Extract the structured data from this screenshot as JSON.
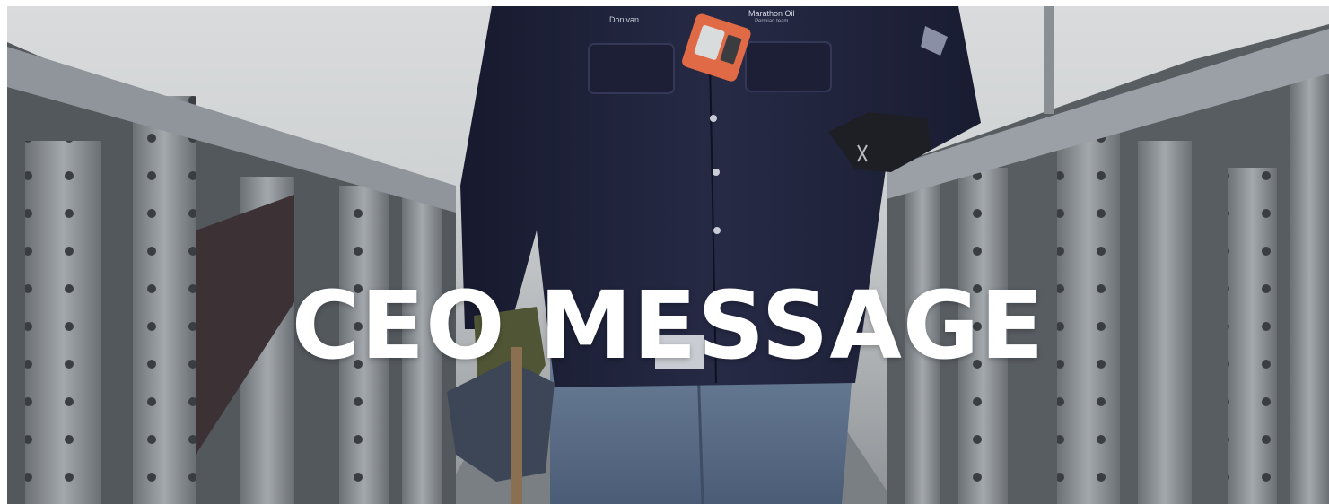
{
  "hero": {
    "headline": "CEO MESSAGE",
    "name_tag": "Donivan",
    "brand_logo": "Marathon Oil",
    "brand_logo_sub": "Permian team"
  },
  "colors": {
    "headline": "#ffffff",
    "shirt": "#1f2239",
    "steel": "#8d9399",
    "jeans": "#5a6f8c",
    "gas_detector": "#e06a45"
  }
}
